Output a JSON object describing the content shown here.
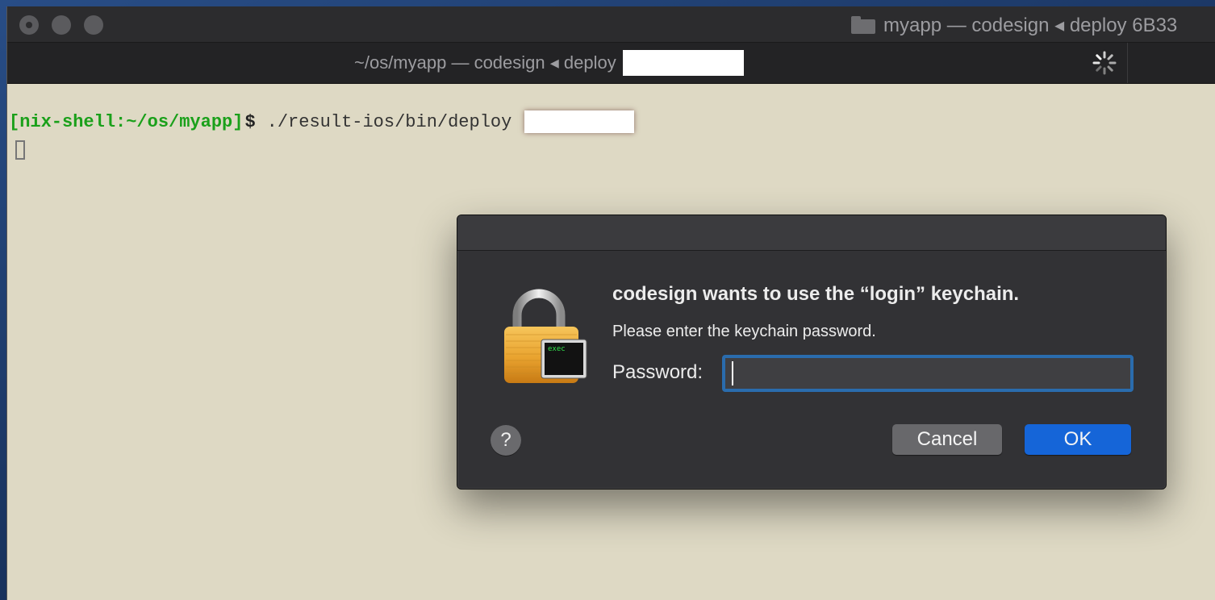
{
  "window": {
    "title": "myapp — codesign ◂ deploy 6B33"
  },
  "tab": {
    "title": "~/os/myapp — codesign ◂ deploy"
  },
  "terminal": {
    "prompt_open": "[",
    "prompt": "[nix-shell:~/os/myapp]",
    "dollar": "$",
    "command": "./result-ios/bin/deploy"
  },
  "dialog": {
    "heading": "codesign wants to use the “login” keychain.",
    "message": "Please enter the keychain password.",
    "password_label": "Password:",
    "password_value": "",
    "help_label": "?",
    "cancel_label": "Cancel",
    "ok_label": "OK",
    "lock_badge_text": "exec"
  },
  "colors": {
    "terminal_background": "#ded9c4",
    "prompt_green": "#1aa01a",
    "dialog_background": "#323235",
    "ok_button": "#1565d8",
    "cancel_button": "#68686b",
    "focus_ring": "#2a6cad"
  },
  "icons": {
    "window_close": "close-icon",
    "folder": "folder-icon",
    "activity": "spinner-icon",
    "keychain": "lock-icon",
    "badge": "terminal-icon"
  }
}
